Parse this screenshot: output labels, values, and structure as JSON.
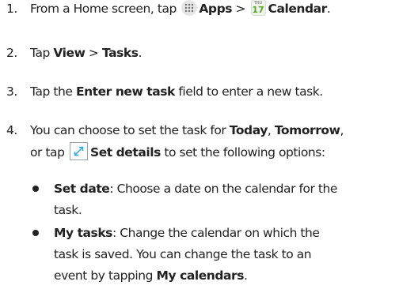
{
  "steps": [
    {
      "number": "1.",
      "t1": "From a Home screen, tap ",
      "apps_label": "Apps",
      "sep": " > ",
      "calendar_icon_day": "THU",
      "calendar_icon_date": "17",
      "calendar_label": "Calendar",
      "t_end": "."
    },
    {
      "number": "2.",
      "t1": "Tap ",
      "view_label": "View",
      "sep": " > ",
      "tasks_label": "Tasks",
      "t_end": "."
    },
    {
      "number": "3.",
      "t1": "Tap the ",
      "field_label": "Enter new task",
      "t2": " field to enter a new task."
    },
    {
      "number": "4.",
      "line1_t1": "You can choose to set the task for ",
      "today_label": "Today",
      "comma": ", ",
      "tomorrow_label": "Tomorrow",
      "comma2": ",",
      "line2_t1": "or tap ",
      "set_details_label": "Set details",
      "line2_t2": " to set the following options:"
    }
  ],
  "options": [
    {
      "title": "Set date",
      "line1": ": Choose a date on the calendar for the",
      "line2": "task."
    },
    {
      "title": "My tasks",
      "line1": ": Change the calendar on which the",
      "line2": "task is saved. You can change the task to an",
      "line3_t1": "event by tapping ",
      "line3_bold": "My calendars",
      "line3_end": "."
    }
  ],
  "icons": {
    "apps": "apps-grid-icon",
    "calendar": "calendar-app-icon",
    "set_details": "expand-diagonal-icon"
  },
  "colors": {
    "text": "#222222",
    "calendar_accent": "#5aa025",
    "icon_outline": "#9aa0a6"
  }
}
